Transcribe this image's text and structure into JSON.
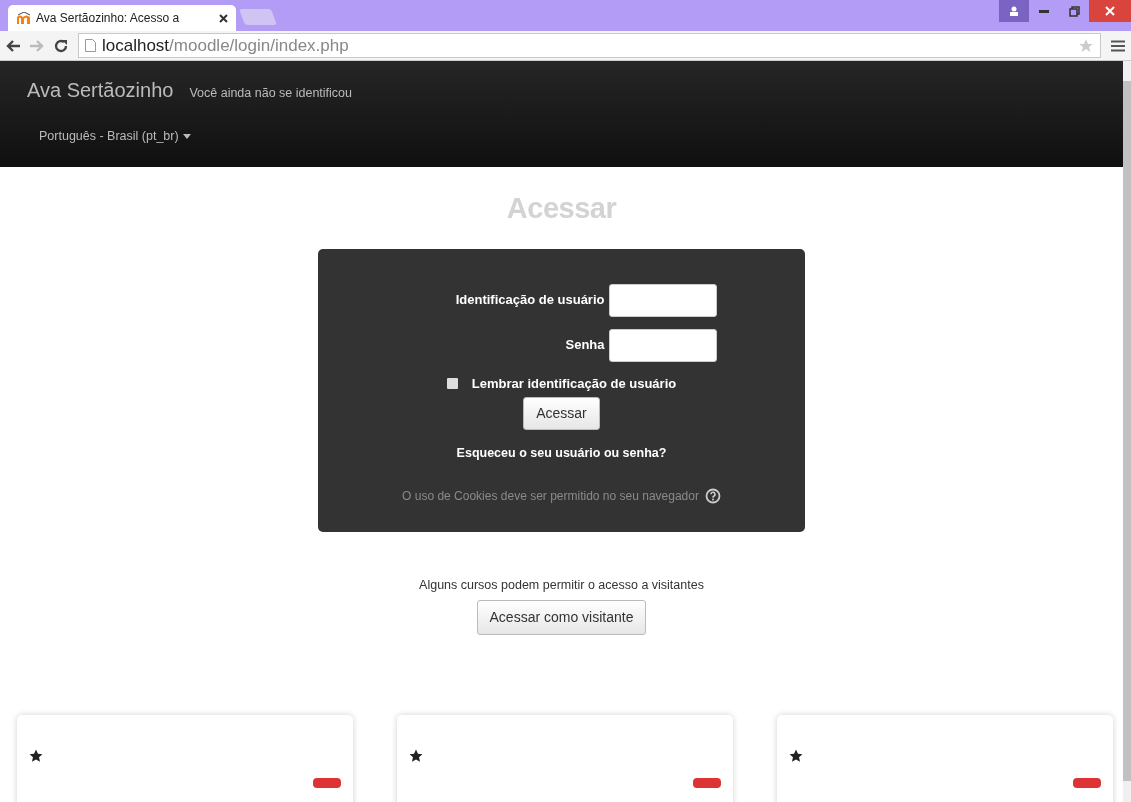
{
  "browser": {
    "tab_title": "Ava Sertãozinho: Acesso a",
    "url_host": "localhost",
    "url_path": "/moodle/login/index.php"
  },
  "navbar": {
    "brand": "Ava Sertãozinho",
    "login_info": "Você ainda não se identificou",
    "language": "Português - Brasil (pt_br)"
  },
  "heading": "Acessar",
  "login": {
    "fields": [
      {
        "label": "Identificação de usuário"
      },
      {
        "label": "Senha"
      }
    ],
    "remember": {
      "label": "Lembrar identificação de usuário",
      "checked": false
    },
    "submit": "Acessar",
    "forgot": "Esqueceu o seu usuário ou senha?",
    "cookies": "O uso de Cookies deve ser permitido no seu navegador"
  },
  "guest": {
    "note": "Alguns cursos podem permitir o acesso a visitantes",
    "button": "Acessar como visitante"
  },
  "cards": [
    {
      "starred": true
    },
    {
      "starred": true
    },
    {
      "starred": true
    }
  ]
}
